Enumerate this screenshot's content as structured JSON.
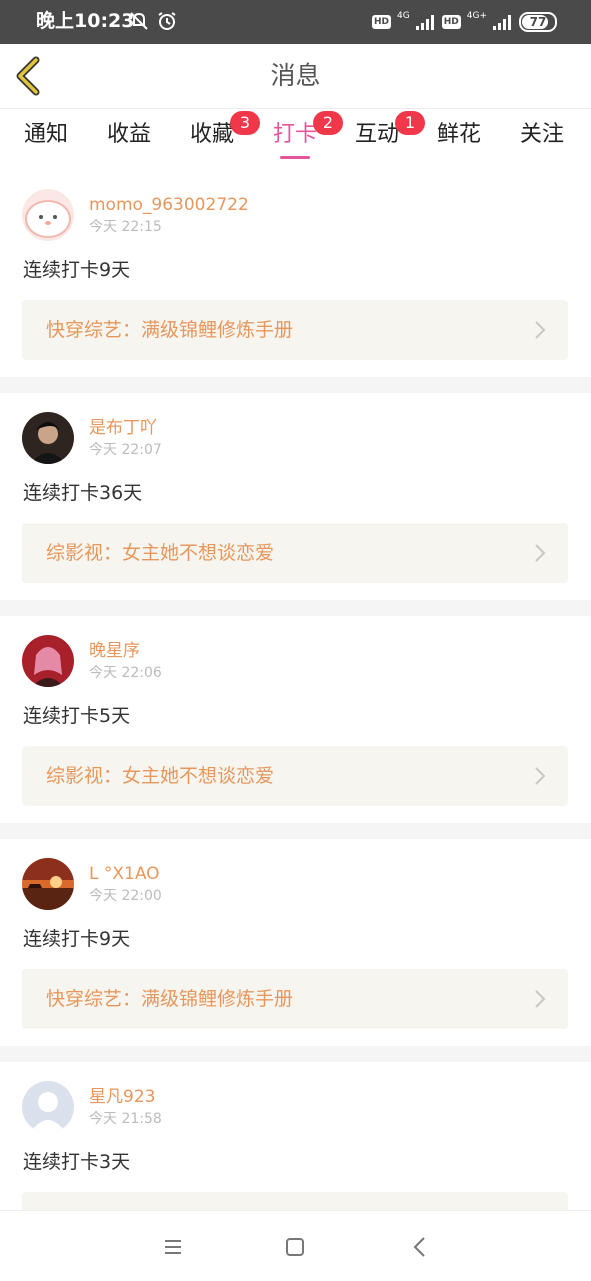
{
  "status_bar": {
    "time": "晚上10:23",
    "net1": "4G",
    "net2": "4G+",
    "hd1": "HD",
    "hd2": "HD",
    "battery": "77"
  },
  "header": {
    "title": "消息"
  },
  "tabs": [
    {
      "label": "通知",
      "badge": ""
    },
    {
      "label": "收益",
      "badge": ""
    },
    {
      "label": "收藏",
      "badge": "3"
    },
    {
      "label": "打卡",
      "badge": "2",
      "active": true
    },
    {
      "label": "互动",
      "badge": "1"
    },
    {
      "label": "鲜花",
      "badge": ""
    },
    {
      "label": "关注",
      "badge": ""
    }
  ],
  "messages": [
    {
      "user": "momo_963002722",
      "time": "今天 22:15",
      "text": "连续打卡9天",
      "book": "快穿综艺：满级锦鲤修炼手册",
      "avatar_color": "#f6c9c4"
    },
    {
      "user": "是布丁吖",
      "time": "今天 22:07",
      "text": "连续打卡36天",
      "book": "综影视：女主她不想谈恋爱",
      "avatar_color": "#3a2b22"
    },
    {
      "user": "晚星序",
      "time": "今天 22:06",
      "text": "连续打卡5天",
      "book": "综影视：女主她不想谈恋爱",
      "avatar_color": "#b8232e"
    },
    {
      "user": "L °X1AO",
      "time": "今天 22:00",
      "text": "连续打卡9天",
      "book": "快穿综艺：满级锦鲤修炼手册",
      "avatar_color": "#c4552a"
    },
    {
      "user": "星凡923",
      "time": "今天 21:58",
      "text": "连续打卡3天",
      "book": "",
      "avatar_color": "#d6dce8"
    }
  ],
  "colors": {
    "accent": "#e6559b",
    "username": "#e8975c",
    "badge": "#f0384a",
    "back_icon": "#e2c63a"
  }
}
